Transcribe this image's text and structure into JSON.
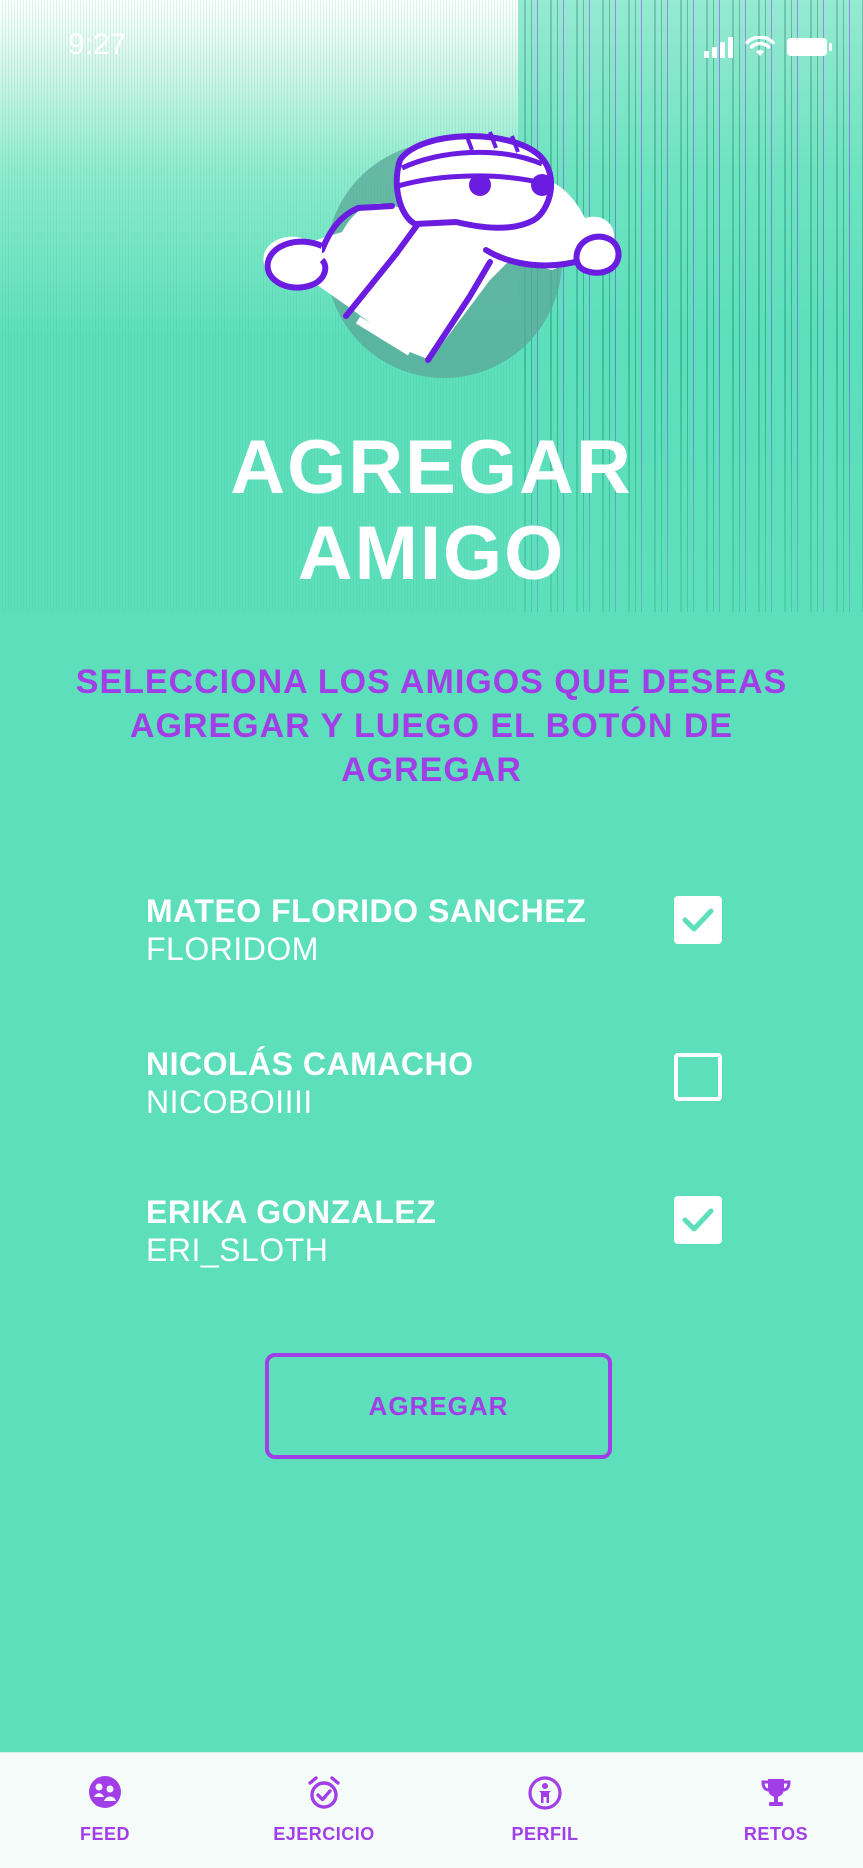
{
  "status_bar": {
    "time": "9:27"
  },
  "page": {
    "title_line1": "AGREGAR",
    "title_line2": "AMIGO"
  },
  "instructions": "SELECCIONA LOS AMIGOS QUE DESEAS AGREGAR Y LUEGO EL BOTÓN DE AGREGAR",
  "friends": [
    {
      "name": "MATEO FLORIDO SANCHEZ",
      "username": "FLORIDOM",
      "selected": true
    },
    {
      "name": "NICOLÁS CAMACHO",
      "username": "NICOBOIIII",
      "selected": false
    },
    {
      "name": "ERIKA GONZALEZ",
      "username": "ERI_SLOTH",
      "selected": true
    }
  ],
  "add_button": "AGREGAR",
  "tabs": [
    {
      "label": "FEED",
      "icon": "feed-icon"
    },
    {
      "label": "EJERCICIO",
      "icon": "alarm-check-icon"
    },
    {
      "label": "PERFIL",
      "icon": "person-icon"
    },
    {
      "label": "RETOS",
      "icon": "trophy-icon"
    }
  ],
  "colors": {
    "background": "#5ddfbb",
    "accent": "#a23ee8",
    "white": "#ffffff"
  }
}
